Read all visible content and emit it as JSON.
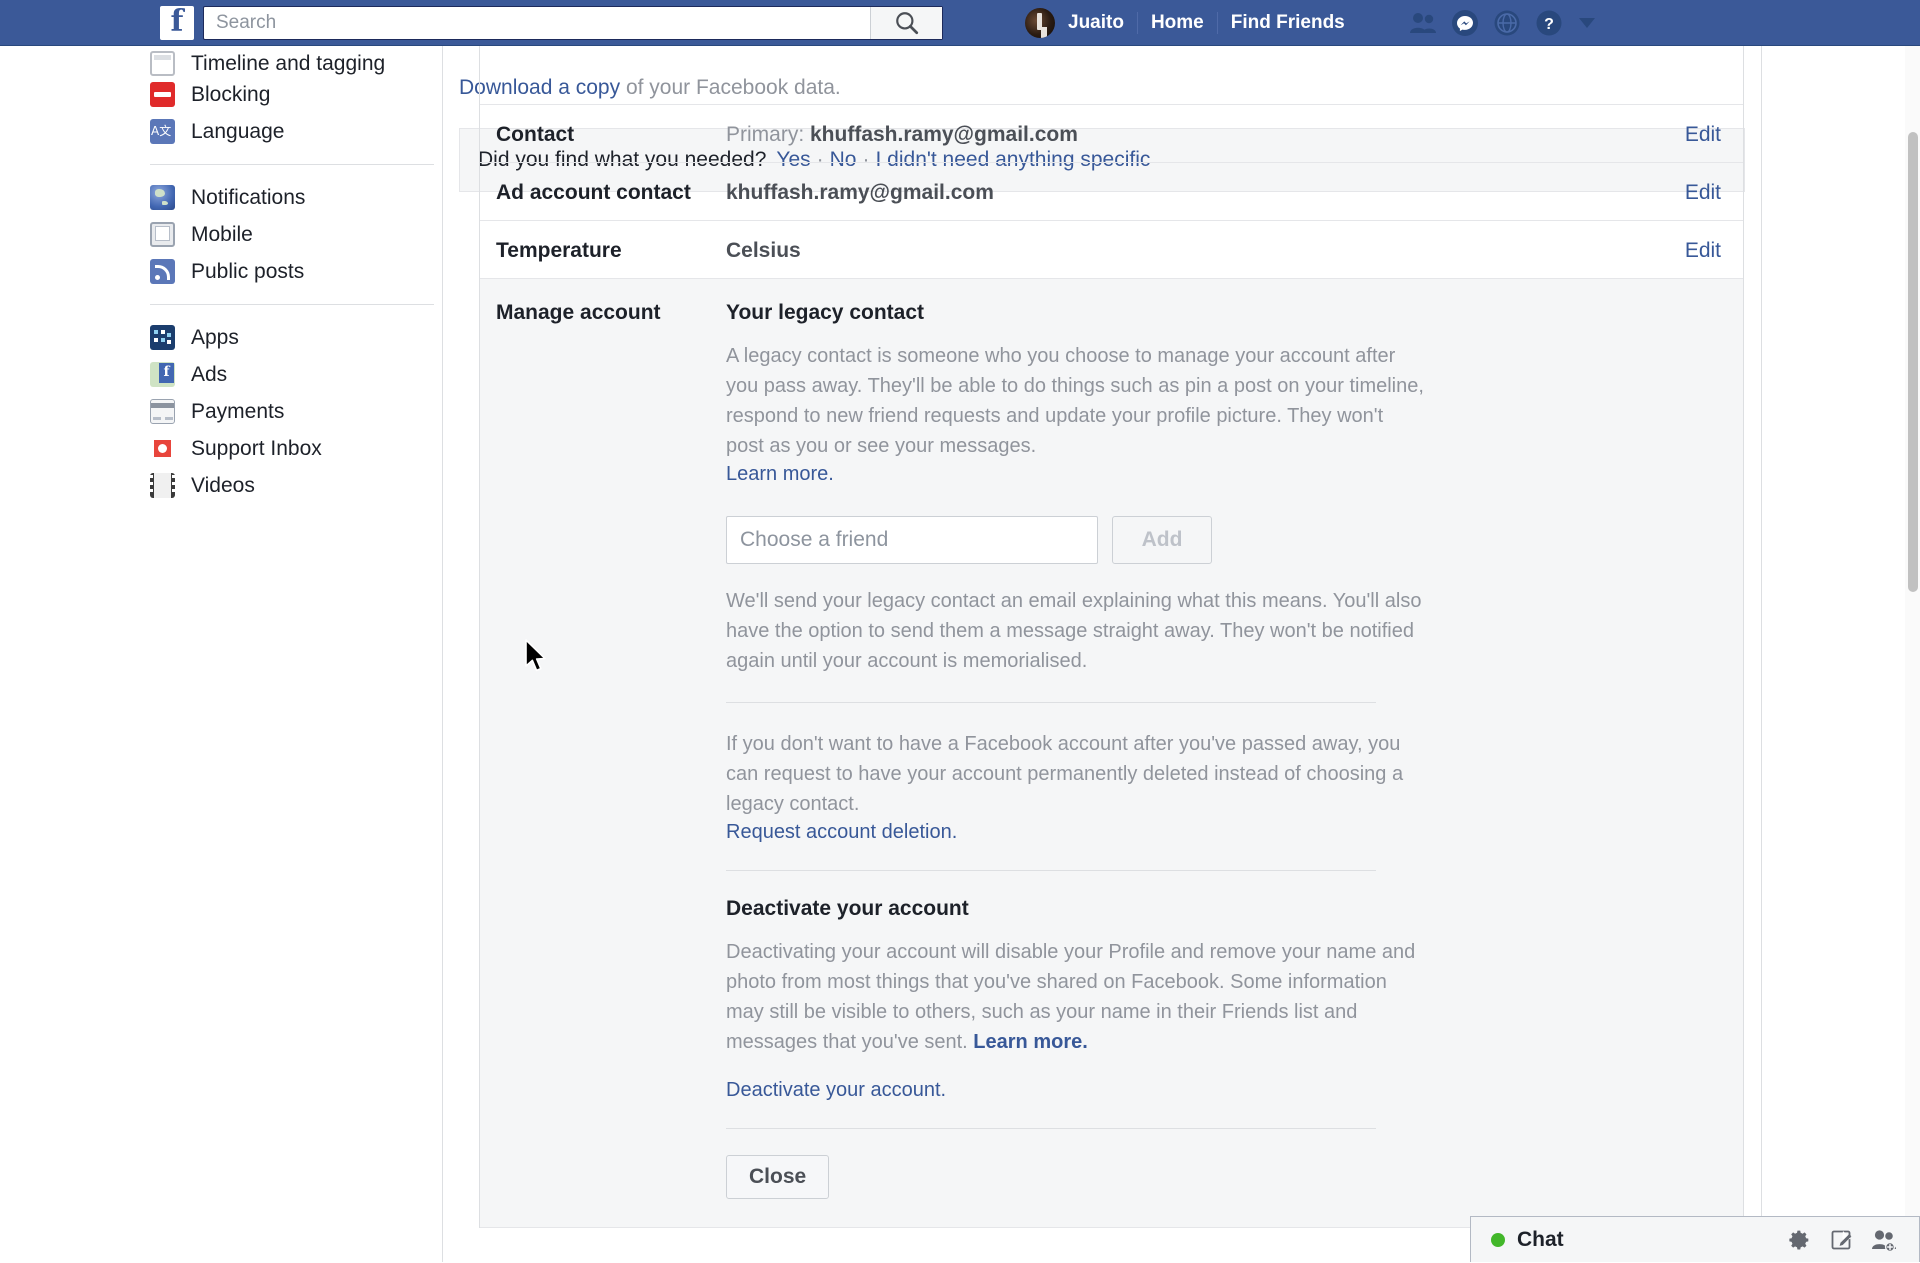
{
  "topbar": {
    "logo": "f",
    "search": {
      "placeholder": "Search",
      "value": ""
    },
    "search_icon": "search-icon",
    "profile_name": "Juaito",
    "home_label": "Home",
    "find_friends_label": "Find Friends",
    "icons": [
      "friend-requests-icon",
      "messenger-icon",
      "notifications-globe-icon",
      "help-icon",
      "account-caret-icon"
    ],
    "brand_color": "#3b5998"
  },
  "sidebar": {
    "groups": [
      {
        "items": [
          {
            "label": "Timeline and tagging",
            "icon": "timeline-icon"
          },
          {
            "label": "Blocking",
            "icon": "blocking-icon"
          },
          {
            "label": "Language",
            "icon": "language-icon"
          }
        ]
      },
      {
        "items": [
          {
            "label": "Notifications",
            "icon": "notifications-icon"
          },
          {
            "label": "Mobile",
            "icon": "mobile-icon"
          },
          {
            "label": "Public posts",
            "icon": "public-posts-icon"
          }
        ]
      },
      {
        "items": [
          {
            "label": "Apps",
            "icon": "apps-icon"
          },
          {
            "label": "Ads",
            "icon": "ads-icon"
          },
          {
            "label": "Payments",
            "icon": "payments-icon"
          },
          {
            "label": "Support Inbox",
            "icon": "support-inbox-icon"
          },
          {
            "label": "Videos",
            "icon": "videos-icon"
          }
        ]
      }
    ]
  },
  "settings": {
    "rows": [
      {
        "label": "Contact",
        "value_prefix": "Primary: ",
        "value": "khuffash.ramy@gmail.com",
        "edit_label": "Edit"
      },
      {
        "label": "Ad account contact",
        "value_prefix": "",
        "value": "khuffash.ramy@gmail.com",
        "edit_label": "Edit"
      },
      {
        "label": "Temperature",
        "value_prefix": "",
        "value": "Celsius",
        "edit_label": "Edit"
      }
    ],
    "manage_account": {
      "label": "Manage account",
      "legacy_title": "Your legacy contact",
      "legacy_desc": "A legacy contact is someone who you choose to manage your account after you pass away. They'll be able to do things such as pin a post on your timeline, respond to new friend requests and update your profile picture. They won't post as you or see your messages.",
      "learn_more_label": "Learn more.",
      "friend_input_placeholder": "Choose a friend",
      "friend_input_value": "",
      "add_button_label": "Add",
      "email_note": "We'll send your legacy contact an email explaining what this means. You'll also have the option to send them a message straight away. They won't be notified again until your account is memorialised.",
      "deletion_desc": "If you don't want to have a Facebook account after you've passed away, you can request to have your account permanently deleted instead of choosing a legacy contact.",
      "request_deletion_label": "Request account deletion.",
      "deactivate_title": "Deactivate your account",
      "deactivate_desc": "Deactivating your account will disable your Profile and remove your name and photo from most things that you've shared on Facebook. Some information may still be visible to others, such as your name in their Friends list and messages that you've sent. ",
      "deactivate_learn_more": "Learn more.",
      "deactivate_link_label": "Deactivate your account.",
      "close_button_label": "Close"
    },
    "download": {
      "link_label": "Download a copy",
      "rest": " of your Facebook data."
    },
    "feedback": {
      "question": "Did you find what you needed?",
      "yes_label": "Yes",
      "no_label": "No",
      "neither_label": "I didn't need anything specific",
      "separator": "·"
    }
  },
  "chat": {
    "label": "Chat",
    "status_color": "#42b72a",
    "icons": [
      "chat-settings-gear-icon",
      "new-message-icon",
      "add-people-icon"
    ]
  }
}
